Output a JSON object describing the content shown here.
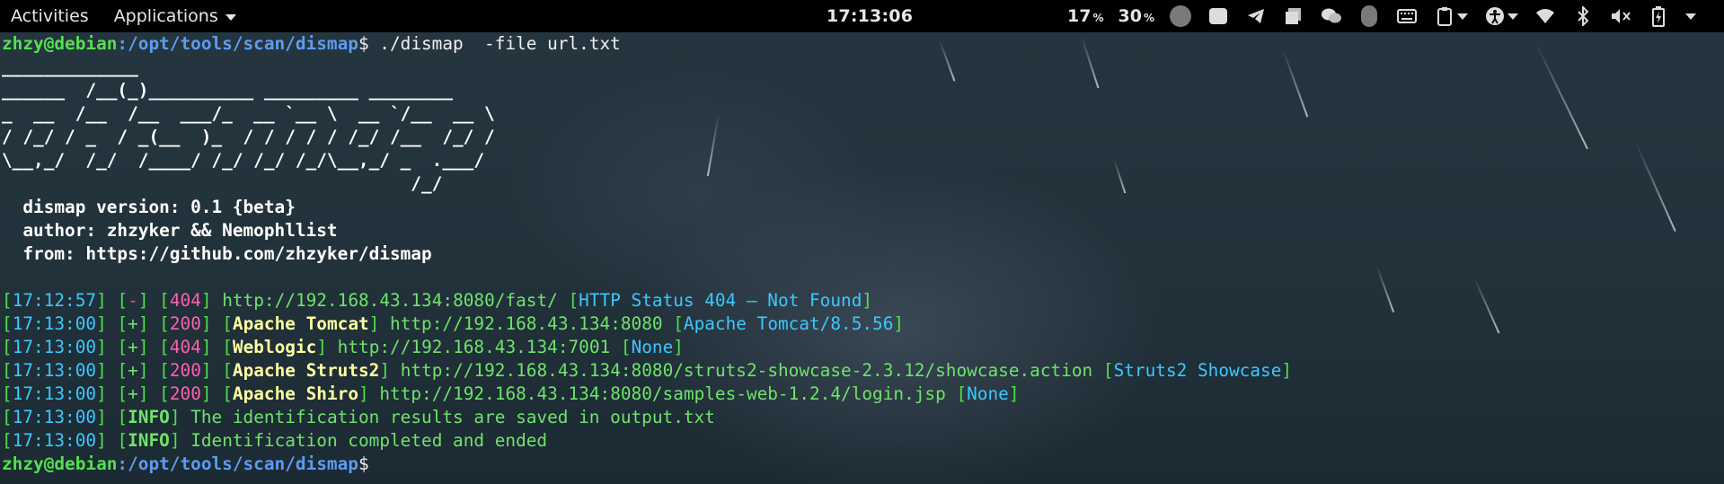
{
  "topbar": {
    "activities": "Activities",
    "applications": "Applications",
    "clock": "17:13:06",
    "cpu_value": "17",
    "mem_value": "30",
    "pct_symbol": "%"
  },
  "terminal": {
    "prompt_user": "zhzy@debian",
    "prompt_path": ":/opt/tools/scan/dismap",
    "prompt_symbol": "$",
    "command": " ./dismap  -file url.txt",
    "banner": [
      "_____________",
      "______  /__(_)__________ _________ ________",
      "_  __  /__  /__  ___/_  __ `__ \\  __ `/__  __ \\",
      "/ /_/ / _  / _(__  )_  / / / / / /_/ /__  /_/ /",
      "\\__,_/  /_/  /____/ /_/ /_/ /_/\\__,_/ _  .___/",
      "                                       /_/"
    ],
    "info": [
      "  dismap version: 0.1 {beta}",
      "  author: zhzyker && Nemophllist",
      "  from: https://github.com/zhzyker/dismap"
    ],
    "results": [
      {
        "time": "17:12:57",
        "flag": "-",
        "code": "404",
        "name": "",
        "url": "http://192.168.43.134:8080/fast/",
        "detail": "HTTP Status 404 – Not Found"
      },
      {
        "time": "17:13:00",
        "flag": "+",
        "code": "200",
        "name": "Apache Tomcat",
        "url": "http://192.168.43.134:8080",
        "detail": "Apache Tomcat/8.5.56"
      },
      {
        "time": "17:13:00",
        "flag": "+",
        "code": "404",
        "name": "Weblogic",
        "url": "http://192.168.43.134:7001",
        "detail": "None"
      },
      {
        "time": "17:13:00",
        "flag": "+",
        "code": "200",
        "name": "Apache Struts2",
        "url": "http://192.168.43.134:8080/struts2-showcase-2.3.12/showcase.action",
        "detail": "Struts2 Showcase"
      },
      {
        "time": "17:13:00",
        "flag": "+",
        "code": "200",
        "name": "Apache Shiro",
        "url": "http://192.168.43.134:8080/samples-web-1.2.4/login.jsp",
        "detail": "None"
      }
    ],
    "messages": [
      {
        "time": "17:13:00",
        "tag": "INFO",
        "text": " The identification results are saved in output.txt"
      },
      {
        "time": "17:13:00",
        "tag": "INFO",
        "text": " Identification completed and ended"
      }
    ]
  },
  "colors": {
    "prompt_user": "#53e04f",
    "prompt_path": "#5d9cf0",
    "banner": "#ff5fb0",
    "url": "#6fe36a",
    "detail": "#3cc8ff",
    "name": "#ffffa0"
  },
  "icons": [
    "app-circle-icon",
    "screenshot-icon",
    "telegram-icon",
    "clipboard-stack-icon",
    "wechat-icon",
    "lock-circle-icon",
    "keyboard-icon",
    "clipboard-icon",
    "accessibility-icon",
    "wifi-icon",
    "bluetooth-icon",
    "volume-muted-icon",
    "battery-icon",
    "power-dropdown-icon"
  ]
}
